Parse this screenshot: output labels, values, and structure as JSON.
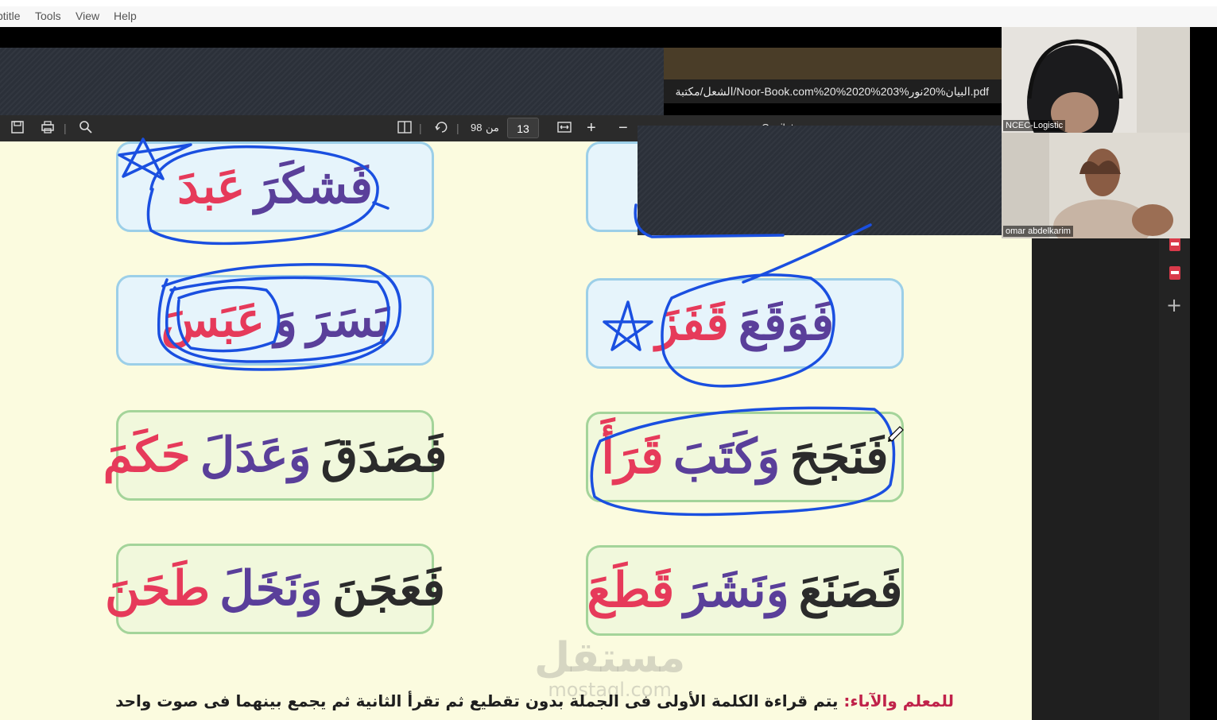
{
  "menubar": {
    "items": [
      "btitle",
      "Tools",
      "View",
      "Help"
    ]
  },
  "address_bar": {
    "url": "الشعل/مكتبة/Noor-Book.com%20%2020%203%البيان%20نور.pdf"
  },
  "pdf_toolbar": {
    "page_current": "13",
    "page_of_label": "من",
    "page_total": "98",
    "copilot_label": "Copilot"
  },
  "cards": [
    {
      "style": "blue",
      "words": [
        {
          "text": "عَبدَ",
          "color": "red"
        },
        {
          "text": "فَشكَرَ",
          "color": "purple"
        }
      ]
    },
    {
      "style": "blue",
      "words": []
    },
    {
      "style": "blue",
      "words": [
        {
          "text": "عَبَسَ",
          "color": "red"
        },
        {
          "text": "وَ",
          "color": "purple"
        },
        {
          "text": "بَسَرَ",
          "color": "purple"
        }
      ]
    },
    {
      "style": "blue",
      "words": [
        {
          "text": "قَفَزَ",
          "color": "red"
        },
        {
          "text": "فَوَقَعَ",
          "color": "purple"
        }
      ]
    },
    {
      "style": "green",
      "words": [
        {
          "text": "حَكَمَ",
          "color": "red"
        },
        {
          "text": "وَعَدَلَ",
          "color": "purple"
        },
        {
          "text": "فَصَدَقَ",
          "color": "dark"
        }
      ]
    },
    {
      "style": "green",
      "words": [
        {
          "text": "قَرَأَ",
          "color": "red"
        },
        {
          "text": "وَكَتَبَ",
          "color": "purple"
        },
        {
          "text": "فَنَجَحَ",
          "color": "dark"
        }
      ]
    },
    {
      "style": "green",
      "words": [
        {
          "text": "طَحَنَ",
          "color": "red"
        },
        {
          "text": "وَنَخَلَ",
          "color": "purple"
        },
        {
          "text": "فَعَجَنَ",
          "color": "dark"
        }
      ]
    },
    {
      "style": "green",
      "words": [
        {
          "text": "قَطَعَ",
          "color": "red"
        },
        {
          "text": "وَنَشَرَ",
          "color": "purple"
        },
        {
          "text": "فَصَنَعَ",
          "color": "dark"
        }
      ]
    }
  ],
  "instruction": {
    "lead": "للمعلم والآباء:",
    "text": "يتم قراءة الكلمة الأولى فى الجملة بدون تقطيع ثم تقرأ الثانية ثم يجمع بينهما فى صوت واحد"
  },
  "watermark": {
    "arabic": "مستقل",
    "latin": "mostaql.com"
  },
  "participants": [
    {
      "name": "NCEC-Logistic"
    },
    {
      "name": "omar abdelkarim"
    }
  ],
  "colors": {
    "ink": "#1a4fe0",
    "red": "#e63a5a",
    "purple": "#5a3f9a",
    "page": "#fbfbdf"
  }
}
